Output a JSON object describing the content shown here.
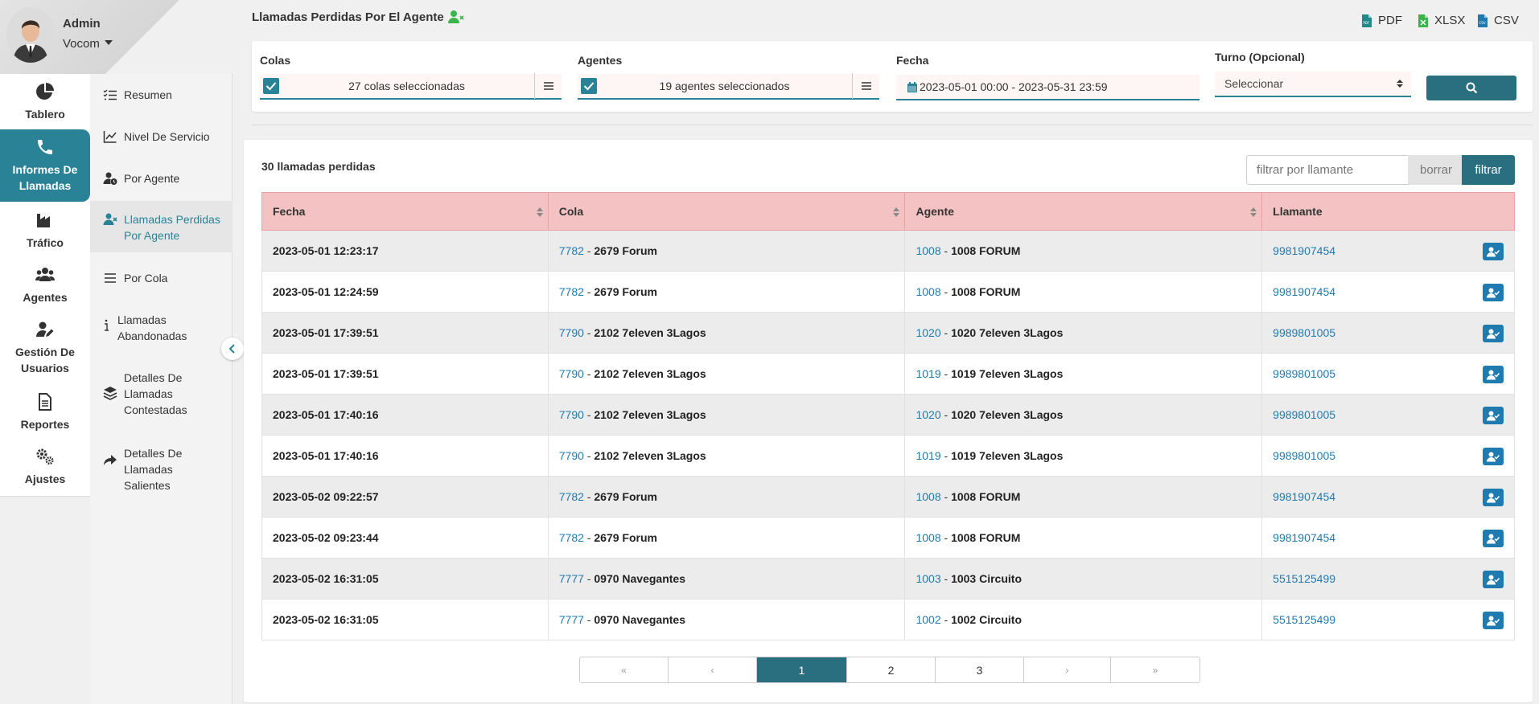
{
  "profile": {
    "name": "Admin",
    "company": "Vocom"
  },
  "rail": [
    {
      "label": "Tablero",
      "icon": "pie-chart-icon"
    },
    {
      "label": "Informes De Llamadas",
      "icon": "phone-icon",
      "active": true
    },
    {
      "label": "Tráfico",
      "icon": "factory-icon"
    },
    {
      "label": "Agentes",
      "icon": "users-icon"
    },
    {
      "label": "Gestión De Usuarios",
      "icon": "user-edit-icon"
    },
    {
      "label": "Reportes",
      "icon": "document-icon"
    },
    {
      "label": "Ajustes",
      "icon": "gears-icon"
    }
  ],
  "subnav": [
    {
      "label": "Resumen",
      "icon": "list-check-icon"
    },
    {
      "label": "Nivel De Servicio",
      "icon": "line-chart-icon"
    },
    {
      "label": "Por Agente",
      "icon": "user-clock-icon"
    },
    {
      "label": "Llamadas Perdidas Por Agente",
      "icon": "user-x-icon",
      "active": true
    },
    {
      "label": "Por Cola",
      "icon": "bars-icon"
    },
    {
      "label": "Llamadas Abandonadas",
      "icon": "info-icon"
    },
    {
      "label": "Detalles De Llamadas Contestadas",
      "icon": "layers-icon"
    },
    {
      "label": "Detalles De Llamadas Salientes",
      "icon": "share-icon"
    }
  ],
  "page_title": "Llamadas Perdidas Por El Agente",
  "exports": {
    "pdf": "PDF",
    "xlsx": "XLSX",
    "csv": "CSV"
  },
  "filters": {
    "colas_label": "Colas",
    "colas_value": "27 colas seleccionadas",
    "agentes_label": "Agentes",
    "agentes_value": "19 agentes seleccionados",
    "fecha_label": "Fecha",
    "fecha_value": "2023-05-01 00:00 - 2023-05-31 23:59",
    "turno_label": "Turno (Opcional)",
    "turno_value": "Seleccionar"
  },
  "results": {
    "count_label": "30 llamadas perdidas",
    "caller_filter_placeholder": "filtrar por llamante",
    "clear_label": "borrar",
    "filter_label": "filtrar",
    "columns": [
      "Fecha",
      "Cola",
      "Agente",
      "Llamante"
    ],
    "rows": [
      {
        "fecha": "2023-05-01 12:23:17",
        "cola_id": "7782",
        "cola_name": "2679 Forum",
        "agente_id": "1008",
        "agente_name": "1008 FORUM",
        "llamante": "9981907454"
      },
      {
        "fecha": "2023-05-01 12:24:59",
        "cola_id": "7782",
        "cola_name": "2679 Forum",
        "agente_id": "1008",
        "agente_name": "1008 FORUM",
        "llamante": "9981907454"
      },
      {
        "fecha": "2023-05-01 17:39:51",
        "cola_id": "7790",
        "cola_name": "2102 7eleven 3Lagos",
        "agente_id": "1020",
        "agente_name": "1020 7eleven 3Lagos",
        "llamante": "9989801005"
      },
      {
        "fecha": "2023-05-01 17:39:51",
        "cola_id": "7790",
        "cola_name": "2102 7eleven 3Lagos",
        "agente_id": "1019",
        "agente_name": "1019 7eleven 3Lagos",
        "llamante": "9989801005"
      },
      {
        "fecha": "2023-05-01 17:40:16",
        "cola_id": "7790",
        "cola_name": "2102 7eleven 3Lagos",
        "agente_id": "1020",
        "agente_name": "1020 7eleven 3Lagos",
        "llamante": "9989801005"
      },
      {
        "fecha": "2023-05-01 17:40:16",
        "cola_id": "7790",
        "cola_name": "2102 7eleven 3Lagos",
        "agente_id": "1019",
        "agente_name": "1019 7eleven 3Lagos",
        "llamante": "9989801005"
      },
      {
        "fecha": "2023-05-02 09:22:57",
        "cola_id": "7782",
        "cola_name": "2679 Forum",
        "agente_id": "1008",
        "agente_name": "1008 FORUM",
        "llamante": "9981907454"
      },
      {
        "fecha": "2023-05-02 09:23:44",
        "cola_id": "7782",
        "cola_name": "2679 Forum",
        "agente_id": "1008",
        "agente_name": "1008 FORUM",
        "llamante": "9981907454"
      },
      {
        "fecha": "2023-05-02 16:31:05",
        "cola_id": "7777",
        "cola_name": "0970 Navegantes",
        "agente_id": "1003",
        "agente_name": "1003 Circuito",
        "llamante": "5515125499"
      },
      {
        "fecha": "2023-05-02 16:31:05",
        "cola_id": "7777",
        "cola_name": "0970 Navegantes",
        "agente_id": "1002",
        "agente_name": "1002 Circuito",
        "llamante": "5515125499"
      }
    ]
  },
  "pagination": {
    "first": "«",
    "prev": "‹",
    "pages": [
      "1",
      "2",
      "3"
    ],
    "current": "1",
    "next": "›",
    "last": "»"
  },
  "colors": {
    "accent": "#2a8296",
    "accent_dark": "#2a6f80",
    "link": "#1f7ab0",
    "header_bg": "#f4c2c2",
    "success": "#3ab54a"
  }
}
